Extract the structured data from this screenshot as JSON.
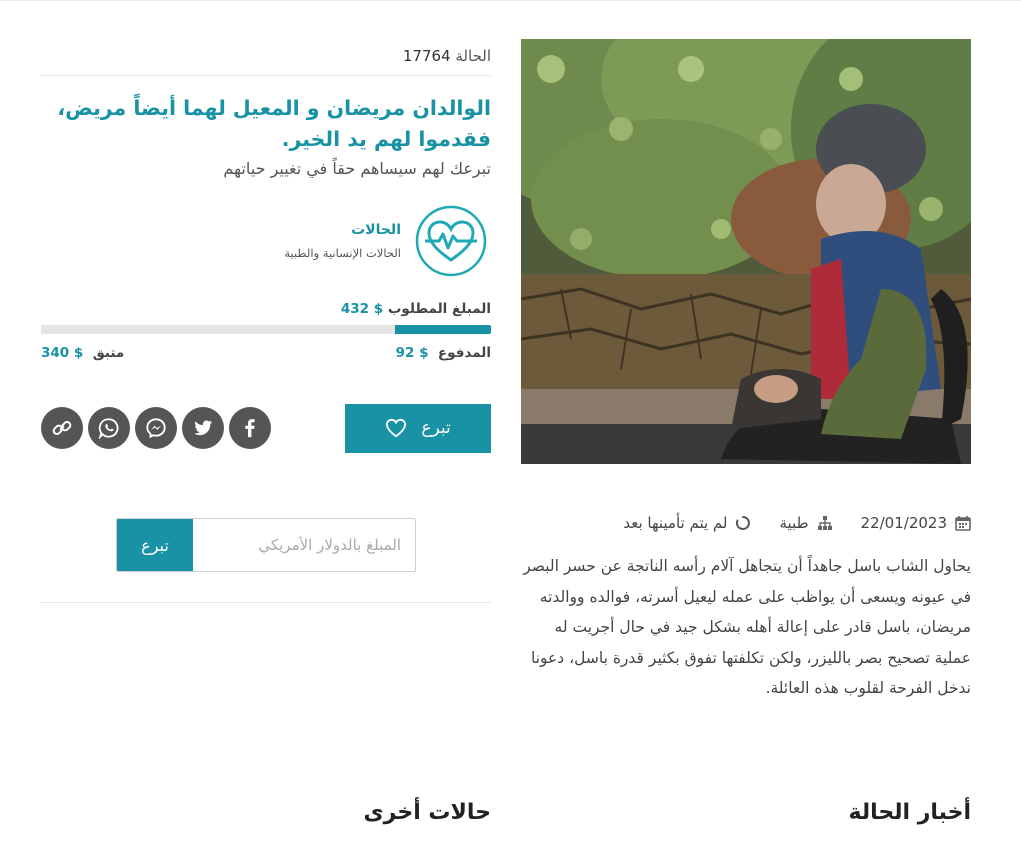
{
  "case": {
    "label": "الحالة",
    "number": "17764",
    "headline": "الوالدان مريضان و المعيل لهما أيضاً مريض، فقدموا لهم يد الخير.",
    "subheadline": "تبرعك لهم سيساهم حقاً في تغيير حياتهم"
  },
  "category": {
    "title": "الحالات",
    "subtitle": "الحالات الإنسانية والطبية",
    "icon": "heartbeat-icon"
  },
  "funding": {
    "required_label": "المبلغ المطلوب",
    "required_value": "432 $",
    "paid_label": "المدفوع",
    "paid_value": "92 $",
    "remaining_label": "متبق",
    "remaining_value": "340 $",
    "progress_fraction": 0.213
  },
  "actions": {
    "donate_label": "تبرع",
    "social": [
      "link-icon",
      "whatsapp-icon",
      "messenger-icon",
      "twitter-icon",
      "facebook-icon"
    ]
  },
  "donate_form": {
    "placeholder": "المبلغ بالدولار الأمريكي",
    "button_label": "تبرع"
  },
  "details": {
    "date": "22/01/2023",
    "type": "طبية",
    "status": "لم يتم تأمينها بعد",
    "description": "يحاول الشاب باسل جاهداً أن يتجاهل آلام رأسه الناتجة عن حسر البصر في عيونه ويسعى أن يواظب على عمله ليعيل أسرته، فوالده ووالدته مريضان، باسل قادر على إعالة أهله بشكل جيد في حال أجريت له عملية تصحيح بصر بالليزر، ولكن تكلفتها تفوق بكثير قدرة باسل، دعونا ندخل الفرحة لقلوب هذه العائلة."
  },
  "sections": {
    "news_title": "أخبار الحالة",
    "other_title": "حالات أخرى"
  },
  "colors": {
    "accent": "#1a92a5",
    "icon_gray": "#555555"
  }
}
